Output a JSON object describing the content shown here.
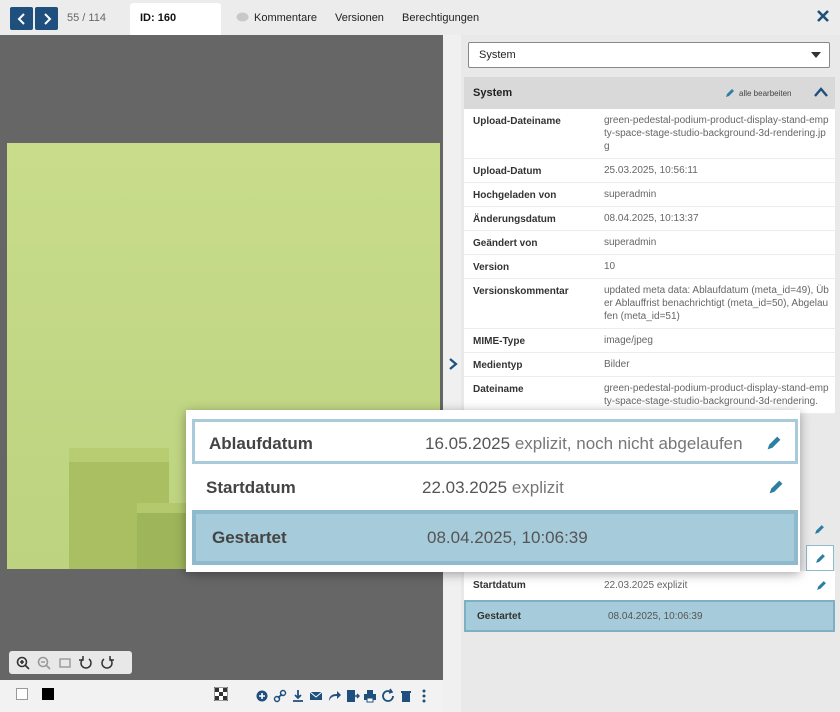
{
  "topbar": {
    "counter": "55 / 114",
    "id_tab": "ID: 160",
    "tabs": [
      "Kommentare",
      "Versionen",
      "Berechtigungen"
    ]
  },
  "sidebar": {
    "dropdown_value": "System",
    "section_title": "System",
    "edit_all_label": "alle bearbeiten",
    "metadata": [
      {
        "key": "Upload-Dateiname",
        "value": "green-pedestal-podium-product-display-stand-empty-space-stage-studio-background-3d-rendering.jpg"
      },
      {
        "key": "Upload-Datum",
        "value": "25.03.2025, 10:56:11"
      },
      {
        "key": "Hochgeladen von",
        "value": "superadmin"
      },
      {
        "key": "Änderungsdatum",
        "value": "08.04.2025, 10:13:37"
      },
      {
        "key": "Geändert von",
        "value": "superadmin"
      },
      {
        "key": "Version",
        "value": "10"
      },
      {
        "key": "Versionskommentar",
        "value": "updated meta data: Ablaufdatum (meta_id=49), Über Ablauffrist benachrichtigt (meta_id=50), Abgelaufen (meta_id=51)"
      },
      {
        "key": "MIME-Type",
        "value": "image/jpeg"
      },
      {
        "key": "Medientyp",
        "value": "Bilder"
      },
      {
        "key": "Dateiname",
        "value": "green-pedestal-podium-product-display-stand-empty-space-stage-studio-background-3d-rendering."
      }
    ],
    "lower_rows": [
      {
        "key": "Startdatum",
        "value": "22.03.2025 explizit"
      },
      {
        "key": "Gestartet",
        "value": "08.04.2025, 10:06:39"
      }
    ]
  },
  "zoom": {
    "ablauf_key": "Ablaufdatum",
    "ablauf_date": "16.05.2025",
    "ablauf_note": "explizit, noch nicht abgelaufen",
    "start_key": "Startdatum",
    "start_date": "22.03.2025",
    "start_note": "explizit",
    "gestartet_key": "Gestartet",
    "gestartet_value": "08.04.2025, 10:06:39"
  },
  "colors": {
    "accent": "#1f4f7c",
    "highlight": "#a6cbda",
    "image_green": "#c6da8a"
  }
}
